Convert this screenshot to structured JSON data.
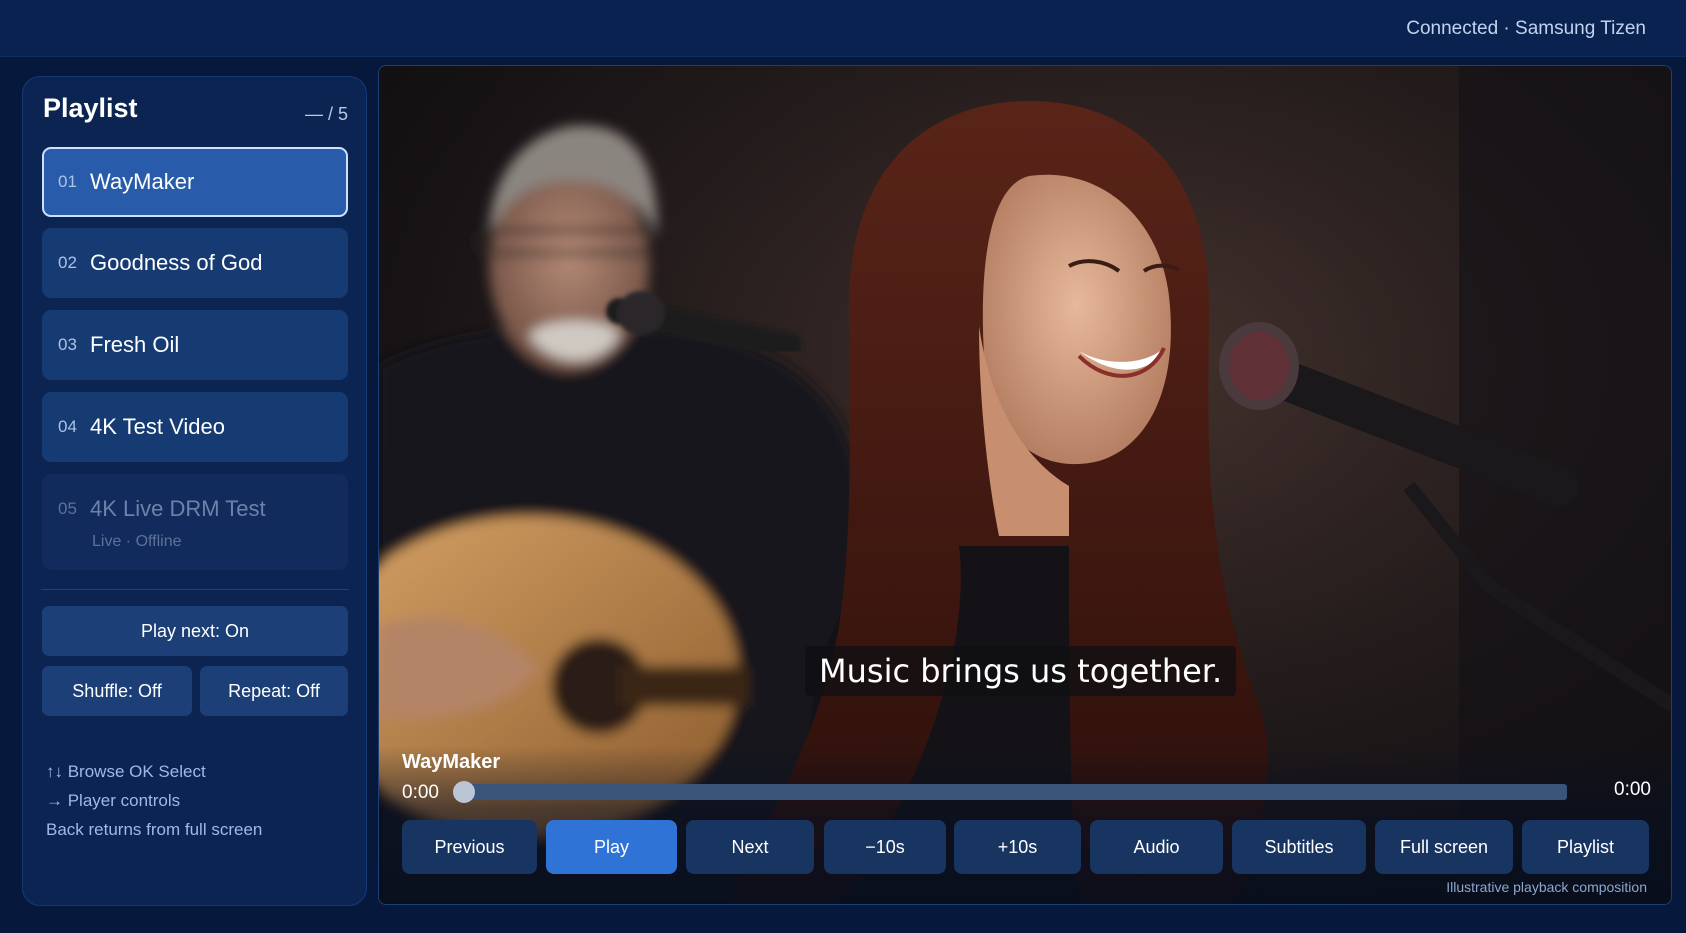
{
  "header": {
    "status": "Connected · Samsung Tizen"
  },
  "sidebar": {
    "title": "Playlist",
    "count": "— / 5",
    "items": [
      {
        "num": "01",
        "title": "WayMaker",
        "sub": ""
      },
      {
        "num": "02",
        "title": "Goodness of God",
        "sub": ""
      },
      {
        "num": "03",
        "title": "Fresh Oil",
        "sub": ""
      },
      {
        "num": "04",
        "title": "4K Test Video",
        "sub": ""
      },
      {
        "num": "05",
        "title": "4K Live DRM Test",
        "sub": "Live · Offline"
      }
    ],
    "play_next": "Play next: On",
    "shuffle": "Shuffle: Off",
    "repeat": "Repeat: Off",
    "help": [
      "↑↓ Browse   OK Select",
      "→ Player controls",
      "Back returns from full screen"
    ]
  },
  "player": {
    "caption": "Music brings us together.",
    "now_playing": "WayMaker",
    "time_current": "0:00",
    "time_duration": "0:00",
    "progress": 0,
    "buttons": {
      "previous": "Previous",
      "play": "Play",
      "next": "Next",
      "back10": "−10s",
      "fwd10": "+10s",
      "audio": "Audio",
      "subtitles": "Subtitles",
      "fullscreen": "Full screen",
      "playlist": "Playlist"
    },
    "footnote": "Illustrative playback composition"
  },
  "colors": {
    "accent": "#2f73d6",
    "selected": "#285cab",
    "background": "#06193d"
  }
}
